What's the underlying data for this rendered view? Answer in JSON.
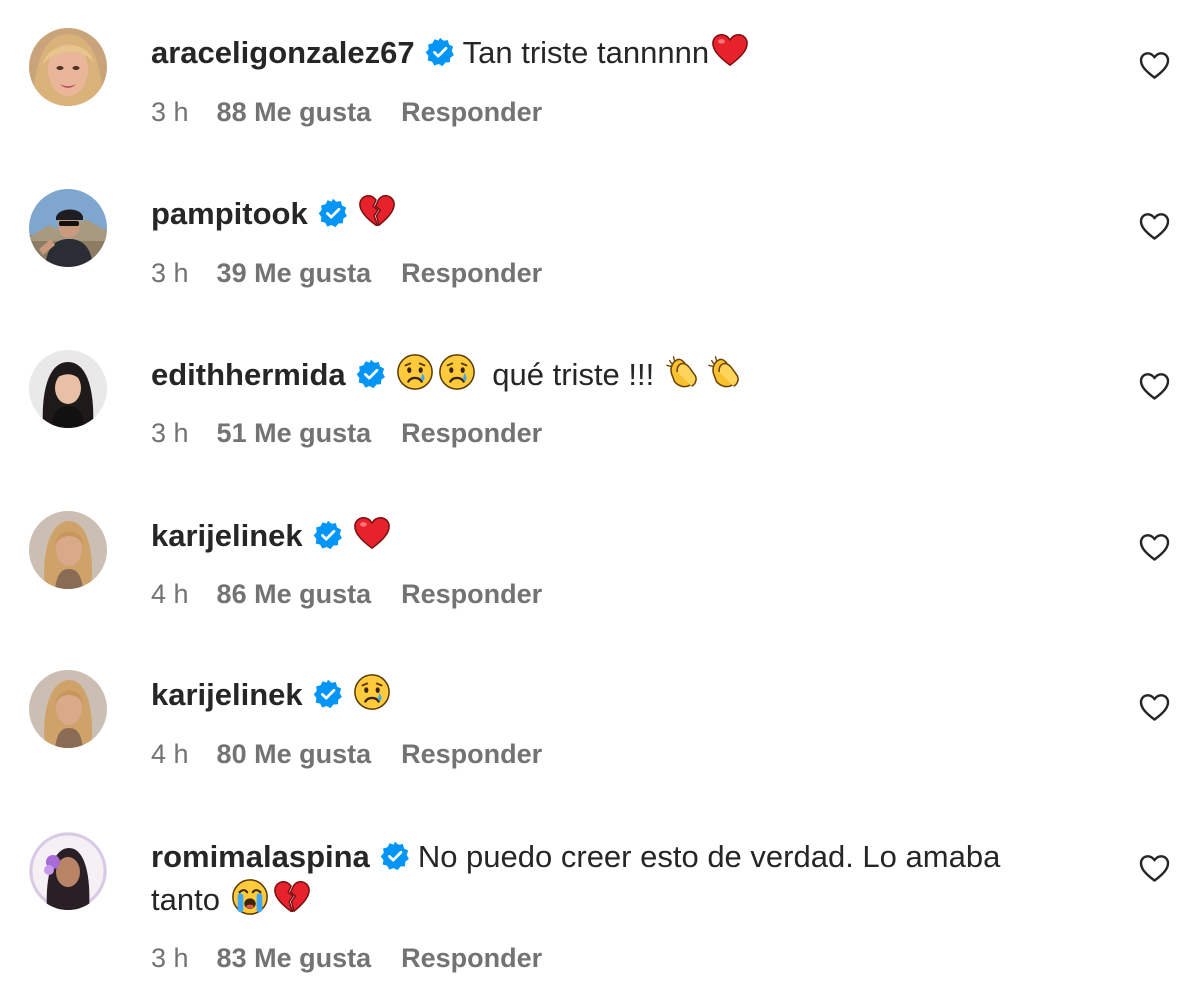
{
  "comments": [
    {
      "username": "araceligonzalez67",
      "text": "Tan triste tannnnn",
      "emojis_after": [
        "red-heart"
      ],
      "time": "3 h",
      "likes": "88 Me gusta",
      "reply": "Responder",
      "avatar": "woman-blonde-avatar"
    },
    {
      "username": "pampitook",
      "text": "",
      "emojis_after": [
        "broken-heart"
      ],
      "time": "3 h",
      "likes": "39 Me gusta",
      "reply": "Responder",
      "avatar": "person-outdoors-avatar"
    },
    {
      "username": "edithhermida",
      "text_before_emojis": [
        "crying-face",
        "crying-face"
      ],
      "text": "qué triste !!!",
      "emojis_after": [
        "clapping-hands",
        "clapping-hands"
      ],
      "time": "3 h",
      "likes": "51 Me gusta",
      "reply": "Responder",
      "avatar": "woman-dark-hair-avatar"
    },
    {
      "username": "karijelinek",
      "text": "",
      "emojis_after": [
        "red-heart"
      ],
      "time": "4 h",
      "likes": "86 Me gusta",
      "reply": "Responder",
      "avatar": "woman-blonde-selfie-avatar"
    },
    {
      "username": "karijelinek",
      "text": "",
      "emojis_after": [
        "crying-face"
      ],
      "time": "4 h",
      "likes": "80 Me gusta",
      "reply": "Responder",
      "avatar": "woman-blonde-selfie-avatar"
    },
    {
      "username": "romimalaspina",
      "text": "No puedo creer esto de verdad. Lo amaba",
      "text_line2": "tanto",
      "emojis_after": [
        "loudly-crying-face",
        "broken-heart"
      ],
      "time": "3 h",
      "likes": "83 Me gusta",
      "reply": "Responder",
      "avatar": "woman-purple-avatar"
    }
  ],
  "colors": {
    "text": "#262626",
    "meta": "#737373",
    "verified": "#0095F6",
    "heart_outline": "#262626"
  }
}
